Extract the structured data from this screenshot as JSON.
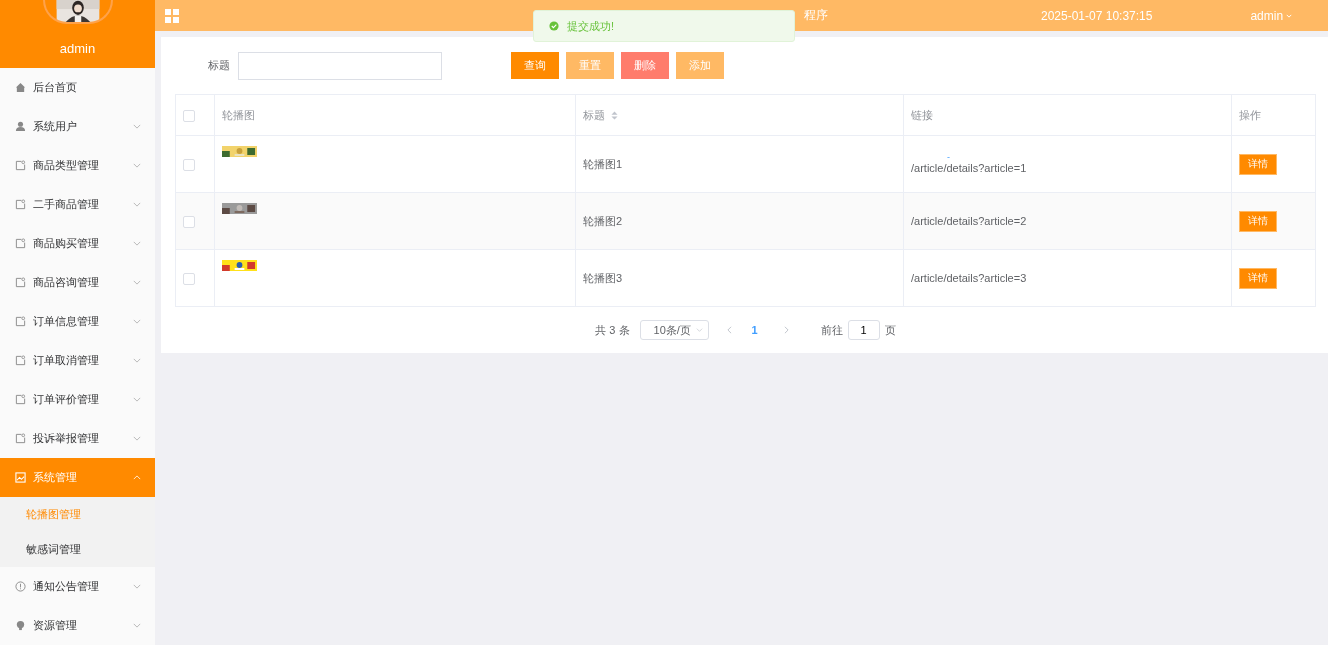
{
  "sidebar": {
    "user": "admin",
    "items": [
      {
        "label": "后台首页",
        "selected": false
      },
      {
        "label": "系统用户",
        "selected": false,
        "expanded": false
      },
      {
        "label": "商品类型管理",
        "selected": false,
        "expanded": false
      },
      {
        "label": "二手商品管理",
        "selected": false,
        "expanded": false
      },
      {
        "label": "商品购买管理",
        "selected": false,
        "expanded": false
      },
      {
        "label": "商品咨询管理",
        "selected": false,
        "expanded": false
      },
      {
        "label": "订单信息管理",
        "selected": false,
        "expanded": false
      },
      {
        "label": "订单取消管理",
        "selected": false,
        "expanded": false
      },
      {
        "label": "订单评价管理",
        "selected": false,
        "expanded": false
      },
      {
        "label": "投诉举报管理",
        "selected": false,
        "expanded": false
      },
      {
        "label": "系统管理",
        "selected": true,
        "expanded": true,
        "children": [
          {
            "label": "轮播图管理",
            "selected": true
          },
          {
            "label": "敏感词管理",
            "selected": false
          }
        ]
      },
      {
        "label": "通知公告管理",
        "selected": false,
        "expanded": false
      },
      {
        "label": "资源管理",
        "selected": false,
        "expanded": false
      }
    ]
  },
  "header": {
    "title": "程序",
    "datetime": "2025-01-07 10:37:15",
    "user": "admin"
  },
  "toast": {
    "message": "提交成功!"
  },
  "search": {
    "label": "标题"
  },
  "buttons": [
    {
      "label": "查询",
      "color": "#ff8a00"
    },
    {
      "label": "重置",
      "color": "#ffb964"
    },
    {
      "label": "删除",
      "color": "#ff7c6c"
    },
    {
      "label": "添加",
      "color": "#ffb964"
    }
  ],
  "table": {
    "header_checked": false,
    "columns": [
      "轮播图",
      "标题",
      "链接",
      "操作"
    ],
    "rows": [
      {
        "checked": false,
        "title": "轮播图1",
        "link_note": "-",
        "link": "/article/details?article=1",
        "action": "详情"
      },
      {
        "checked": false,
        "title": "轮播图2",
        "link": "/article/details?article=2",
        "action": "详情"
      },
      {
        "checked": false,
        "title": "轮播图3",
        "link": "/article/details?article=3",
        "action": "详情"
      }
    ]
  },
  "pagination": {
    "total": "共 3 条",
    "page_size": "10条/页",
    "pages": [
      {
        "label": "1",
        "selected": true
      }
    ],
    "goto_label": "前往",
    "goto_value": "1",
    "goto_suffix": "页"
  }
}
